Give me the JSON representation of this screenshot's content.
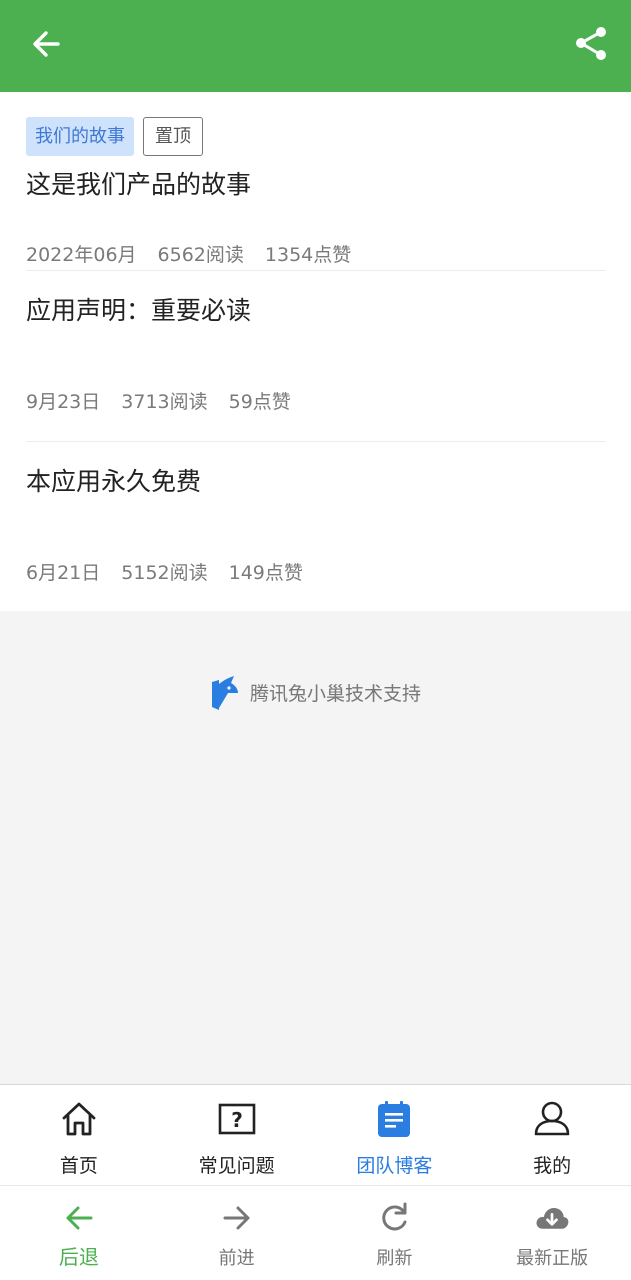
{
  "colors": {
    "header": "#4cb050",
    "accent_blue": "#2a7de1",
    "tag_bg": "#cfe2fb",
    "back_green": "#4cb050"
  },
  "header": {
    "back_icon": "arrow-left-icon",
    "share_icon": "share-icon"
  },
  "articles": [
    {
      "category": "我们的故事",
      "pinned": "置顶",
      "title": "这是我们产品的故事",
      "date": "2022年06月",
      "reads": "6562阅读",
      "likes": "1354点赞"
    },
    {
      "title": "应用声明：重要必读",
      "date": "9月23日",
      "reads": "3713阅读",
      "likes": "59点赞"
    },
    {
      "title": "本应用永久免费",
      "date": "6月21日",
      "reads": "5152阅读",
      "likes": "149点赞"
    }
  ],
  "support": {
    "text": "腾讯兔小巢技术支持",
    "icon": "txc-logo-icon"
  },
  "tabbar": {
    "items": [
      {
        "label": "首页",
        "icon": "home-icon"
      },
      {
        "label": "常见问题",
        "icon": "question-icon"
      },
      {
        "label": "团队博客",
        "icon": "notepad-icon",
        "active": true
      },
      {
        "label": "我的",
        "icon": "user-icon"
      }
    ]
  },
  "navbar": {
    "items": [
      {
        "label": "后退",
        "icon": "arrow-left-icon",
        "active": true
      },
      {
        "label": "前进",
        "icon": "arrow-right-icon"
      },
      {
        "label": "刷新",
        "icon": "refresh-icon"
      },
      {
        "label": "最新正版",
        "icon": "cloud-download-icon"
      }
    ]
  }
}
